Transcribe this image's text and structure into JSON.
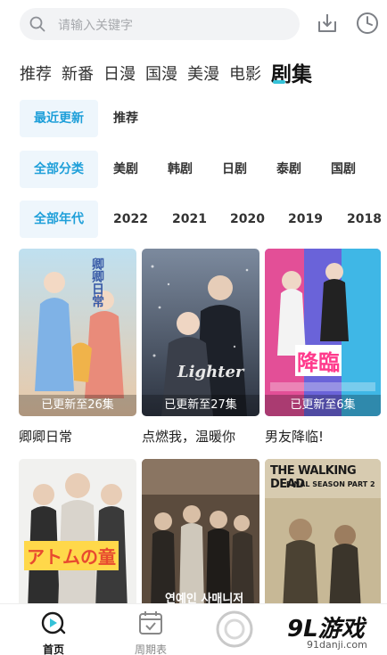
{
  "search": {
    "placeholder": "请输入关键字"
  },
  "header_icons": [
    "download-icon",
    "history-clock-icon"
  ],
  "category_tabs": [
    {
      "label": "推荐",
      "active": false
    },
    {
      "label": "新番",
      "active": false
    },
    {
      "label": "日漫",
      "active": false
    },
    {
      "label": "国漫",
      "active": false
    },
    {
      "label": "美漫",
      "active": false
    },
    {
      "label": "电影",
      "active": false
    },
    {
      "label": "剧集",
      "active": true
    }
  ],
  "filters": {
    "sort": {
      "selected": "最近更新",
      "options": [
        "推荐"
      ]
    },
    "type": {
      "selected": "全部分类",
      "options": [
        "美剧",
        "韩剧",
        "日剧",
        "泰剧",
        "国剧"
      ]
    },
    "year": {
      "selected": "全部年代",
      "options": [
        "2022",
        "2021",
        "2020",
        "2019",
        "2018"
      ]
    }
  },
  "cards": [
    {
      "title": "卿卿日常",
      "badge": "已更新至26集",
      "poster_text": "卿卿日常"
    },
    {
      "title": "点燃我，温暖你",
      "badge": "已更新至27集",
      "poster_text": "Lighter"
    },
    {
      "title": "男友降临!",
      "badge": "已更新至6集",
      "poster_text": "降臨"
    },
    {
      "title": "",
      "badge": "",
      "poster_text": "アトムの童"
    },
    {
      "title": "",
      "badge": "",
      "poster_text": "연예인 사매니저"
    },
    {
      "title": "",
      "badge": "",
      "poster_text": "THE WALKING DEAD",
      "poster_subtext": "FINAL SEASON PART 2"
    }
  ],
  "bottom_nav": [
    {
      "label": "首页",
      "icon": "home-play-icon",
      "active": true
    },
    {
      "label": "周期表",
      "icon": "calendar-icon",
      "active": false
    }
  ],
  "watermark": {
    "logo": "9L游戏",
    "url": "91danji.com"
  },
  "colors": {
    "accent": "#1e9fd9",
    "tab_underline": "#35c2d8",
    "chip_bg": "#eef6fc"
  }
}
